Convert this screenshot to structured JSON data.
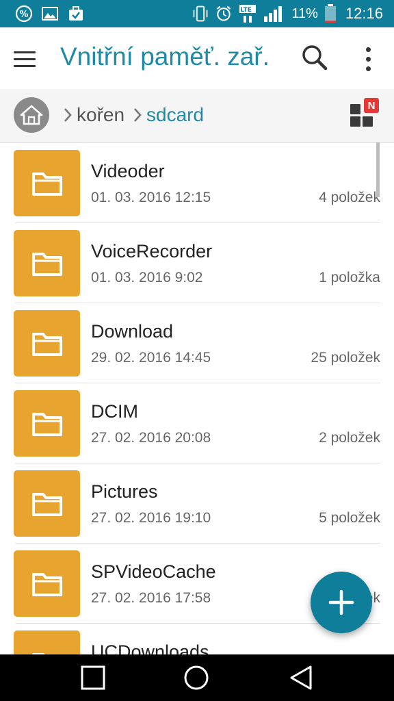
{
  "status_bar": {
    "icons": [
      "percent-badge-icon",
      "image-icon",
      "briefcase-check-icon",
      "vibrate-icon",
      "alarm-icon",
      "lte-icon",
      "signal-icon",
      "battery-icon"
    ],
    "lte_label": "LTE",
    "battery": "11%",
    "time": "12:16",
    "battery_level": 0.11
  },
  "toolbar": {
    "title": "Vnitřní paměť. zař."
  },
  "breadcrumb": {
    "items": [
      "kořen",
      "sdcard"
    ]
  },
  "view_toggle": {
    "badge": "N"
  },
  "files": [
    {
      "name": "Videoder",
      "date": "01. 03. 2016 12:15",
      "count": "4 položek"
    },
    {
      "name": "VoiceRecorder",
      "date": "01. 03. 2016 9:02",
      "count": "1 položka"
    },
    {
      "name": "Download",
      "date": "29. 02. 2016 14:45",
      "count": "25 položek"
    },
    {
      "name": "DCIM",
      "date": "27. 02. 2016 20:08",
      "count": "2 položek"
    },
    {
      "name": "Pictures",
      "date": "27. 02. 2016 19:10",
      "count": "5 položek"
    },
    {
      "name": "SPVideoCache",
      "date": "27. 02. 2016 17:58",
      "count": "1 položek"
    },
    {
      "name": "UCDownloads",
      "date": "",
      "count": ""
    }
  ],
  "colors": {
    "accent": "#0e7e9b",
    "title_blue": "#1f8aa6",
    "folder": "#e7a42e",
    "badge": "#e53935"
  }
}
